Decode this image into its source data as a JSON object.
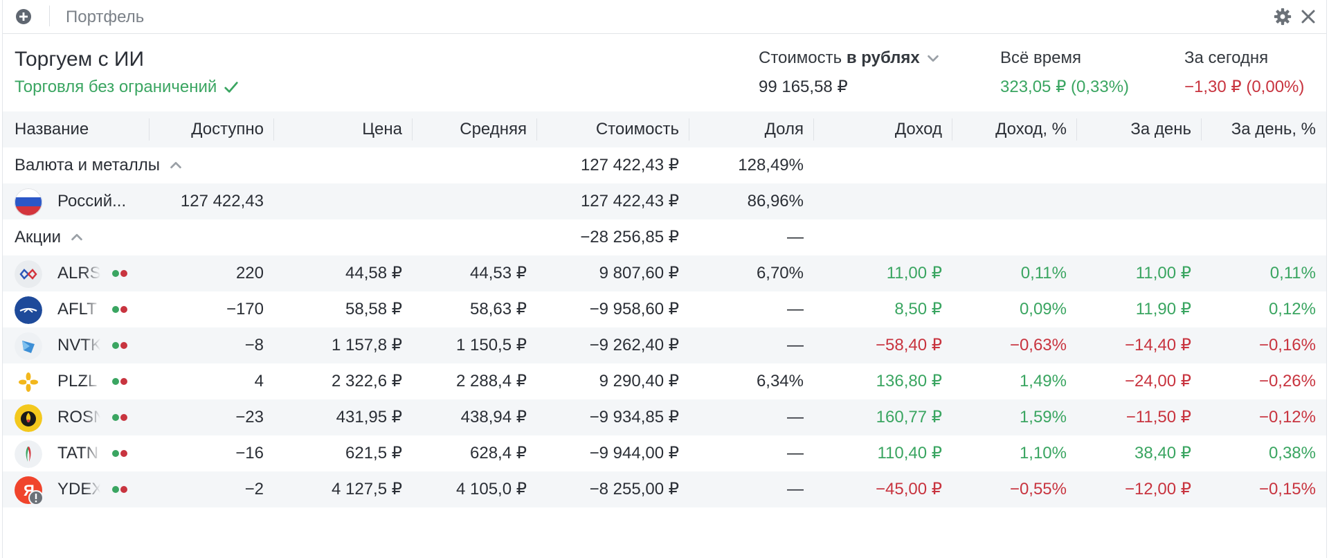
{
  "topbar": {
    "title": "Портфель",
    "add_icon": "plus-circle-icon",
    "settings_icon": "gear-icon",
    "close_icon": "close-icon"
  },
  "account": {
    "name": "Торгуем с ИИ",
    "status": "Торговля без ограничений"
  },
  "stats": {
    "value_label_prefix": "Стоимость",
    "value_label_currency": "в рублях",
    "value": "99 165,58 ₽",
    "alltime_label": "Всё время",
    "alltime_value": "323,05 ₽ (0,33%)",
    "today_label": "За сегодня",
    "today_value": "−1,30 ₽ (0,00%)"
  },
  "columns": [
    "Название",
    "Доступно",
    "Цена",
    "Средняя",
    "Стоимость",
    "Доля",
    "Доход",
    "Доход, %",
    "За день",
    "За день, %"
  ],
  "groups": {
    "currency": {
      "label": "Валюта и металлы",
      "value": "127 422,43 ₽",
      "share": "128,49%"
    },
    "stocks": {
      "label": "Акции",
      "value": "−28 256,85 ₽",
      "share": "—"
    }
  },
  "currency_row": {
    "name": "Россий...",
    "available": "127 422,43",
    "value": "127 422,43 ₽",
    "share": "86,96%"
  },
  "stocks": [
    {
      "ticker": "ALRS",
      "available": "220",
      "price": "44,58 ₽",
      "avg": "44,53 ₽",
      "value": "9 807,60 ₽",
      "share": "6,70%",
      "income": "11,00 ₽",
      "income_pct": "0,11%",
      "day": "11,00 ₽",
      "day_pct": "0,11%"
    },
    {
      "ticker": "AFLT",
      "available": "−170",
      "price": "58,58 ₽",
      "avg": "58,63 ₽",
      "value": "−9 958,60 ₽",
      "share": "—",
      "income": "8,50 ₽",
      "income_pct": "0,09%",
      "day": "11,90 ₽",
      "day_pct": "0,12%"
    },
    {
      "ticker": "NVTK",
      "available": "−8",
      "price": "1 157,8 ₽",
      "avg": "1 150,5 ₽",
      "value": "−9 262,40 ₽",
      "share": "—",
      "income": "−58,40 ₽",
      "income_pct": "−0,63%",
      "day": "−14,40 ₽",
      "day_pct": "−0,16%"
    },
    {
      "ticker": "PLZL",
      "available": "4",
      "price": "2 322,6 ₽",
      "avg": "2 288,4 ₽",
      "value": "9 290,40 ₽",
      "share": "6,34%",
      "income": "136,80 ₽",
      "income_pct": "1,49%",
      "day": "−24,00 ₽",
      "day_pct": "−0,26%"
    },
    {
      "ticker": "ROSN",
      "available": "−23",
      "price": "431,95 ₽",
      "avg": "438,94 ₽",
      "value": "−9 934,85 ₽",
      "share": "—",
      "income": "160,77 ₽",
      "income_pct": "1,59%",
      "day": "−11,50 ₽",
      "day_pct": "−0,12%"
    },
    {
      "ticker": "TATN",
      "available": "−16",
      "price": "621,5 ₽",
      "avg": "628,4 ₽",
      "value": "−9 944,00 ₽",
      "share": "—",
      "income": "110,40 ₽",
      "income_pct": "1,10%",
      "day": "38,40 ₽",
      "day_pct": "0,38%"
    },
    {
      "ticker": "YDEX",
      "available": "−2",
      "price": "4 127,5 ₽",
      "avg": "4 105,0 ₽",
      "value": "−8 255,00 ₽",
      "share": "—",
      "income": "−45,00 ₽",
      "income_pct": "−0,55%",
      "day": "−12,00 ₽",
      "day_pct": "−0,15%"
    }
  ],
  "colors": {
    "positive": "#3aa561",
    "negative": "#c8343f",
    "row_alt": "#f4f6f8",
    "text": "#2b2f36"
  }
}
